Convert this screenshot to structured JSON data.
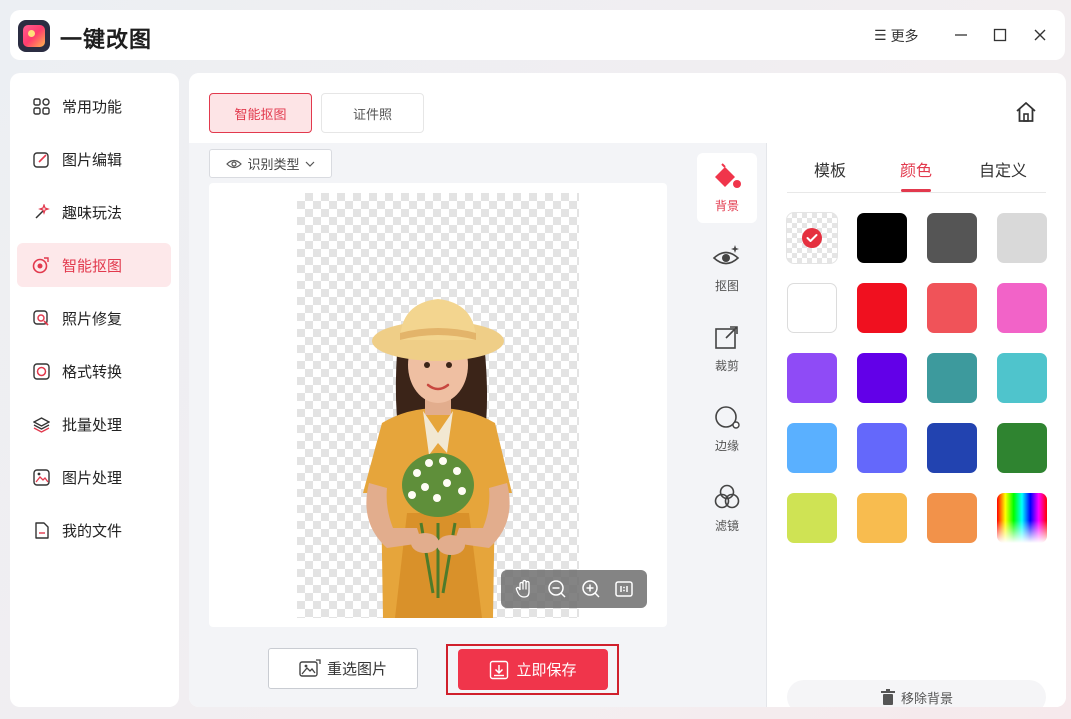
{
  "app": {
    "title": "一键改图",
    "more_label": "更多"
  },
  "sidebar": {
    "items": [
      {
        "label": "常用功能",
        "icon": "grid-icon"
      },
      {
        "label": "图片编辑",
        "icon": "edit-icon"
      },
      {
        "label": "趣味玩法",
        "icon": "sparkle-icon"
      },
      {
        "label": "智能抠图",
        "icon": "cutout-icon",
        "active": true
      },
      {
        "label": "照片修复",
        "icon": "repair-icon"
      },
      {
        "label": "格式转换",
        "icon": "convert-icon"
      },
      {
        "label": "批量处理",
        "icon": "layers-icon"
      },
      {
        "label": "图片处理",
        "icon": "image-icon"
      },
      {
        "label": "我的文件",
        "icon": "file-icon"
      }
    ]
  },
  "main": {
    "tabs": [
      {
        "label": "智能抠图",
        "active": true
      },
      {
        "label": "证件照"
      }
    ],
    "type_select": "识别类型",
    "reselect_label": "重选图片",
    "save_label": "立即保存"
  },
  "tools": [
    {
      "label": "背景",
      "icon": "paint-bucket-icon",
      "active": true
    },
    {
      "label": "抠图",
      "icon": "eye-sparkle-icon"
    },
    {
      "label": "裁剪",
      "icon": "crop-icon"
    },
    {
      "label": "边缘",
      "icon": "edge-icon"
    },
    {
      "label": "滤镜",
      "icon": "filter-icon"
    }
  ],
  "panel": {
    "tabs": [
      "模板",
      "颜色",
      "自定义"
    ],
    "active_tab": "颜色",
    "swatches": [
      "transparent",
      "#000000",
      "#555555",
      "#d9d9d9",
      "#ffffff",
      "#f0101f",
      "#f05359",
      "#f263c8",
      "#8f4bf6",
      "#6200e8",
      "#3d9a9d",
      "#4fc4cc",
      "#5ab0ff",
      "#6468fb",
      "#2243b0",
      "#2f8430",
      "#cfe354",
      "#f8bc4f",
      "#f2924a",
      "rainbow"
    ],
    "selected_swatch": 0,
    "remove_bg_label": "移除背景"
  },
  "colors": {
    "accent": "#e2394d",
    "save_button": "#f0354b",
    "active_tab_bg": "#fde4e6"
  }
}
